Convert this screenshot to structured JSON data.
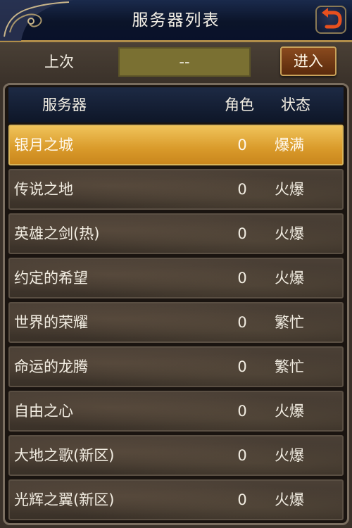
{
  "title": "服务器列表",
  "icons": {
    "back": "back-arrow-icon",
    "ornament": "corner-ornament-icon"
  },
  "last_server": {
    "label": "上次",
    "value": "--",
    "enter_label": "进入"
  },
  "table": {
    "headers": {
      "server": "服务器",
      "role": "角色",
      "status": "状态"
    },
    "rows": [
      {
        "name": "银月之城",
        "count": "0",
        "status": "爆满"
      },
      {
        "name": "传说之地",
        "count": "0",
        "status": "火爆"
      },
      {
        "name": "英雄之剑(热)",
        "count": "0",
        "status": "火爆"
      },
      {
        "name": "约定的希望",
        "count": "0",
        "status": "火爆"
      },
      {
        "name": "世界的荣耀",
        "count": "0",
        "status": "繁忙"
      },
      {
        "name": "命运的龙腾",
        "count": "0",
        "status": "繁忙"
      },
      {
        "name": "自由之心",
        "count": "0",
        "status": "火爆"
      },
      {
        "name": "大地之歌(新区)",
        "count": "0",
        "status": "火爆"
      },
      {
        "name": "光辉之翼(新区)",
        "count": "0",
        "status": "火爆"
      }
    ],
    "selected_index": 0
  },
  "colors": {
    "accent_gold": "#d99a2a",
    "header_navy": "#0e1628",
    "back_arrow": "#e8501e"
  }
}
